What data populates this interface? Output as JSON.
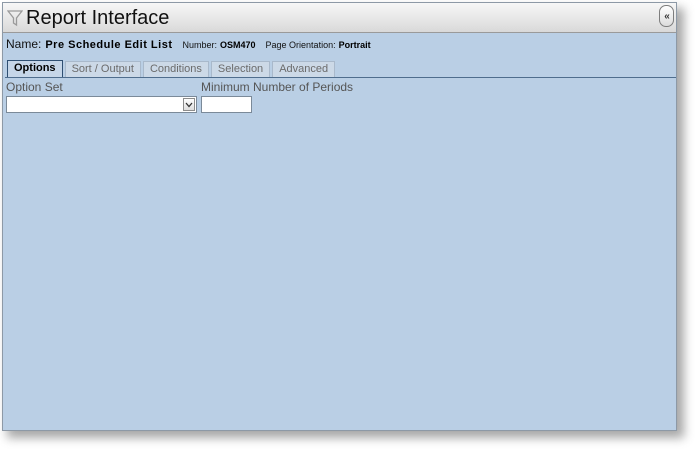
{
  "window": {
    "title": "Report Interface",
    "collapse_label": "«"
  },
  "report": {
    "name_label": "Name:",
    "name_value": "Pre Schedule Edit List",
    "number_label": "Number:",
    "number_value": "OSM470",
    "orientation_label": "Page Orientation:",
    "orientation_value": "Portrait"
  },
  "tabs": [
    {
      "label": "Options",
      "active": true
    },
    {
      "label": "Sort / Output",
      "active": false
    },
    {
      "label": "Conditions",
      "active": false
    },
    {
      "label": "Selection",
      "active": false
    },
    {
      "label": "Advanced",
      "active": false
    }
  ],
  "options": {
    "option_set_label": "Option Set",
    "option_set_value": "",
    "min_periods_label": "Minimum Number of Periods",
    "min_periods_value": ""
  },
  "icons": {
    "title_icon": "funnel-icon",
    "dropdown_icon": "chevron-down-icon"
  }
}
